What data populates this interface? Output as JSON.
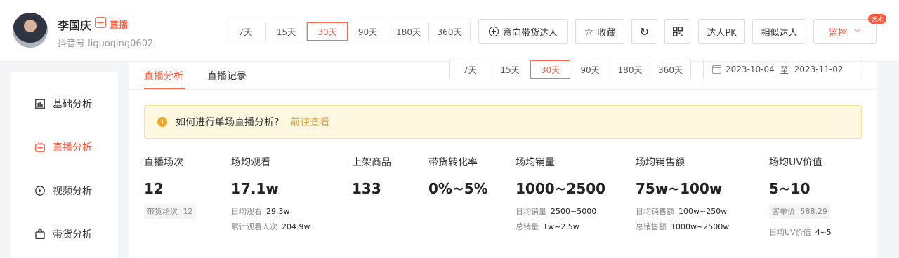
{
  "header": {
    "name": "李国庆",
    "live_badge_text": "直播",
    "douyin_id": "抖音号 liguoqing0602",
    "periods": [
      "7天",
      "15天",
      "30天",
      "90天",
      "180天",
      "360天"
    ],
    "active_period": "30天",
    "buttons": {
      "intent": "意向带货达人",
      "favorite": "收藏",
      "refresh_icon": "refresh-icon",
      "qr_icon": "qrcode-icon",
      "pk": "达人PK",
      "similar": "相似达人",
      "monitor": "监控",
      "hot_tag": "话术"
    }
  },
  "sidebar": {
    "items": [
      {
        "label": "基础分析",
        "icon": "bar-chart-icon"
      },
      {
        "label": "直播分析",
        "icon": "live-icon",
        "active": true
      },
      {
        "label": "视频分析",
        "icon": "play-icon"
      },
      {
        "label": "带货分析",
        "icon": "bag-icon"
      }
    ]
  },
  "main": {
    "tabs": [
      "直播分析",
      "直播记录"
    ],
    "active_tab": "直播分析",
    "periods": [
      "7天",
      "15天",
      "30天",
      "90天",
      "180天",
      "360天"
    ],
    "active_period": "30天",
    "date_start": "2023-10-04",
    "date_sep": "至",
    "date_end": "2023-11-02",
    "notice": {
      "text": "如何进行单场直播分析?",
      "link": "前往查看"
    },
    "metrics": [
      {
        "label": "直播场次",
        "value": "12",
        "sub": [
          {
            "k": "带货场次",
            "v": "12",
            "pill": true
          }
        ]
      },
      {
        "label": "场均观看",
        "value": "17.1w",
        "sub": [
          {
            "k": "日均观看",
            "v": "29.3w"
          },
          {
            "k": "累计观看人次",
            "v": "204.9w"
          }
        ]
      },
      {
        "label": "上架商品",
        "value": "133",
        "sub": []
      },
      {
        "label": "带货转化率",
        "value": "0%~5%",
        "sub": []
      },
      {
        "label": "场均销量",
        "value": "1000~2500",
        "sub": [
          {
            "k": "日均销量",
            "v": "2500~5000"
          },
          {
            "k": "总销量",
            "v": "1w~2.5w"
          }
        ]
      },
      {
        "label": "场均销售额",
        "value": "75w~100w",
        "sub": [
          {
            "k": "日均销售额",
            "v": "100w~250w"
          },
          {
            "k": "总销售额",
            "v": "1000w~2500w"
          }
        ]
      },
      {
        "label": "场均UV价值",
        "value": "5~10",
        "sub": [
          {
            "k": "客单价",
            "v": "588.29",
            "pill": true
          },
          {
            "k": "日均UV价值",
            "v": "4~5"
          }
        ]
      }
    ]
  },
  "colors": {
    "accent": "#ff5a3c",
    "notice_bg": "#fff8e1",
    "notice_link": "#e6a23c"
  }
}
